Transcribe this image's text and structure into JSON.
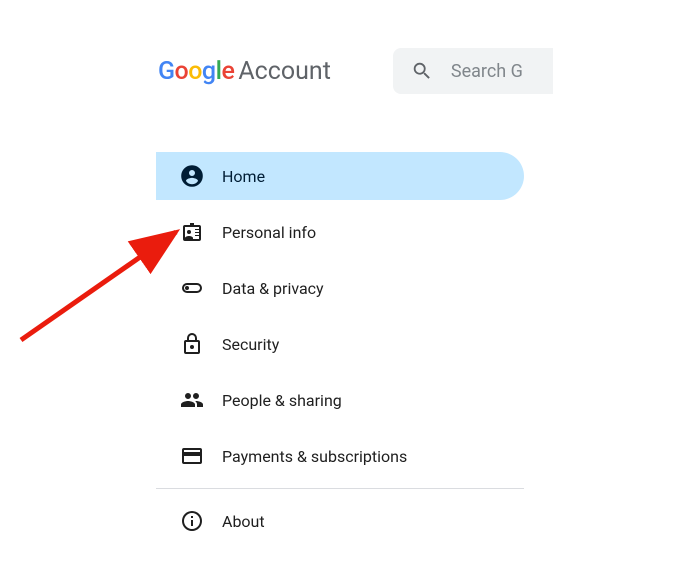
{
  "header": {
    "logo": {
      "letters": [
        "G",
        "o",
        "o",
        "g",
        "l",
        "e"
      ],
      "product": "Account"
    },
    "search_placeholder": "Search G"
  },
  "sidebar": {
    "items": [
      {
        "label": "Home",
        "active": true
      },
      {
        "label": "Personal info",
        "active": false
      },
      {
        "label": "Data & privacy",
        "active": false
      },
      {
        "label": "Security",
        "active": false
      },
      {
        "label": "People & sharing",
        "active": false
      },
      {
        "label": "Payments & subscriptions",
        "active": false
      }
    ],
    "footer_item": {
      "label": "About"
    }
  },
  "annotation": {
    "arrow_color": "#EA1C0D",
    "target": "sidebar-item-personal-info"
  }
}
